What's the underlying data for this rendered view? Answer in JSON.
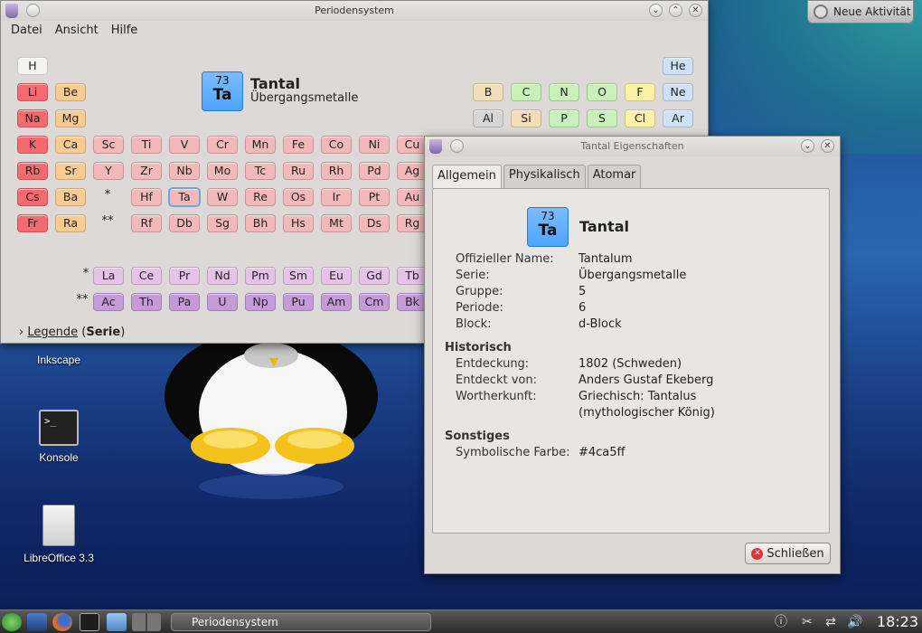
{
  "desktop": {
    "activity_button": "Neue Aktivität",
    "icons": [
      {
        "label": "Inkscape"
      },
      {
        "label": "Konsole"
      },
      {
        "label": "LibreOffice 3.3"
      }
    ]
  },
  "main_window": {
    "title": "Periodensystem",
    "menu": [
      "Datei",
      "Ansicht",
      "Hilfe"
    ],
    "selected": {
      "number": "73",
      "symbol": "Ta",
      "name": "Tantal",
      "series": "Übergangsmetalle"
    },
    "legend_label": "Legende",
    "legend_mode": "Serie",
    "lanthanide_marker": "*",
    "actinide_marker": "**"
  },
  "elements": [
    {
      "sym": "H",
      "series": "nm",
      "col": 0,
      "row": 0
    },
    {
      "sym": "He",
      "series": "nob",
      "col": 17,
      "row": 0
    },
    {
      "sym": "Li",
      "series": "alk",
      "col": 0,
      "row": 1
    },
    {
      "sym": "Be",
      "series": "ale",
      "col": 1,
      "row": 1
    },
    {
      "sym": "B",
      "series": "met",
      "col": 12,
      "row": 1
    },
    {
      "sym": "C",
      "series": "non",
      "col": 13,
      "row": 1
    },
    {
      "sym": "N",
      "series": "non",
      "col": 14,
      "row": 1
    },
    {
      "sym": "O",
      "series": "non",
      "col": 15,
      "row": 1
    },
    {
      "sym": "F",
      "series": "hal",
      "col": 16,
      "row": 1
    },
    {
      "sym": "Ne",
      "series": "nob",
      "col": 17,
      "row": 1
    },
    {
      "sym": "Na",
      "series": "alk",
      "col": 0,
      "row": 2
    },
    {
      "sym": "Mg",
      "series": "ale",
      "col": 1,
      "row": 2
    },
    {
      "sym": "Al",
      "series": "pt",
      "col": 12,
      "row": 2
    },
    {
      "sym": "Si",
      "series": "met",
      "col": 13,
      "row": 2
    },
    {
      "sym": "P",
      "series": "non",
      "col": 14,
      "row": 2
    },
    {
      "sym": "S",
      "series": "non",
      "col": 15,
      "row": 2
    },
    {
      "sym": "Cl",
      "series": "hal",
      "col": 16,
      "row": 2
    },
    {
      "sym": "Ar",
      "series": "nob",
      "col": 17,
      "row": 2
    },
    {
      "sym": "K",
      "series": "alk",
      "col": 0,
      "row": 3
    },
    {
      "sym": "Ca",
      "series": "ale",
      "col": 1,
      "row": 3
    },
    {
      "sym": "Sc",
      "series": "tm",
      "col": 2,
      "row": 3
    },
    {
      "sym": "Ti",
      "series": "tm",
      "col": 3,
      "row": 3
    },
    {
      "sym": "V",
      "series": "tm",
      "col": 4,
      "row": 3
    },
    {
      "sym": "Cr",
      "series": "tm",
      "col": 5,
      "row": 3
    },
    {
      "sym": "Mn",
      "series": "tm",
      "col": 6,
      "row": 3
    },
    {
      "sym": "Fe",
      "series": "tm",
      "col": 7,
      "row": 3
    },
    {
      "sym": "Co",
      "series": "tm",
      "col": 8,
      "row": 3
    },
    {
      "sym": "Ni",
      "series": "tm",
      "col": 9,
      "row": 3
    },
    {
      "sym": "Cu",
      "series": "tm",
      "col": 10,
      "row": 3
    },
    {
      "sym": "Rb",
      "series": "alk",
      "col": 0,
      "row": 4
    },
    {
      "sym": "Sr",
      "series": "ale",
      "col": 1,
      "row": 4
    },
    {
      "sym": "Y",
      "series": "tm",
      "col": 2,
      "row": 4
    },
    {
      "sym": "Zr",
      "series": "tm",
      "col": 3,
      "row": 4
    },
    {
      "sym": "Nb",
      "series": "tm",
      "col": 4,
      "row": 4
    },
    {
      "sym": "Mo",
      "series": "tm",
      "col": 5,
      "row": 4
    },
    {
      "sym": "Tc",
      "series": "tm",
      "col": 6,
      "row": 4
    },
    {
      "sym": "Ru",
      "series": "tm",
      "col": 7,
      "row": 4
    },
    {
      "sym": "Rh",
      "series": "tm",
      "col": 8,
      "row": 4
    },
    {
      "sym": "Pd",
      "series": "tm",
      "col": 9,
      "row": 4
    },
    {
      "sym": "Ag",
      "series": "tm",
      "col": 10,
      "row": 4
    },
    {
      "sym": "Cs",
      "series": "alk",
      "col": 0,
      "row": 5
    },
    {
      "sym": "Ba",
      "series": "ale",
      "col": 1,
      "row": 5
    },
    {
      "sym": "Hf",
      "series": "tm",
      "col": 3,
      "row": 5
    },
    {
      "sym": "Ta",
      "series": "sel",
      "col": 4,
      "row": 5
    },
    {
      "sym": "W",
      "series": "tm",
      "col": 5,
      "row": 5
    },
    {
      "sym": "Re",
      "series": "tm",
      "col": 6,
      "row": 5
    },
    {
      "sym": "Os",
      "series": "tm",
      "col": 7,
      "row": 5
    },
    {
      "sym": "Ir",
      "series": "tm",
      "col": 8,
      "row": 5
    },
    {
      "sym": "Pt",
      "series": "tm",
      "col": 9,
      "row": 5
    },
    {
      "sym": "Au",
      "series": "tm",
      "col": 10,
      "row": 5
    },
    {
      "sym": "Fr",
      "series": "alk",
      "col": 0,
      "row": 6
    },
    {
      "sym": "Ra",
      "series": "ale",
      "col": 1,
      "row": 6
    },
    {
      "sym": "Rf",
      "series": "tm",
      "col": 3,
      "row": 6
    },
    {
      "sym": "Db",
      "series": "tm",
      "col": 4,
      "row": 6
    },
    {
      "sym": "Sg",
      "series": "tm",
      "col": 5,
      "row": 6
    },
    {
      "sym": "Bh",
      "series": "tm",
      "col": 6,
      "row": 6
    },
    {
      "sym": "Hs",
      "series": "tm",
      "col": 7,
      "row": 6
    },
    {
      "sym": "Mt",
      "series": "tm",
      "col": 8,
      "row": 6
    },
    {
      "sym": "Ds",
      "series": "tm",
      "col": 9,
      "row": 6
    },
    {
      "sym": "Rg",
      "series": "tm",
      "col": 10,
      "row": 6
    },
    {
      "sym": "La",
      "series": "lan",
      "col": 2,
      "row": 8
    },
    {
      "sym": "Ce",
      "series": "lan",
      "col": 3,
      "row": 8
    },
    {
      "sym": "Pr",
      "series": "lan",
      "col": 4,
      "row": 8
    },
    {
      "sym": "Nd",
      "series": "lan",
      "col": 5,
      "row": 8
    },
    {
      "sym": "Pm",
      "series": "lan",
      "col": 6,
      "row": 8
    },
    {
      "sym": "Sm",
      "series": "lan",
      "col": 7,
      "row": 8
    },
    {
      "sym": "Eu",
      "series": "lan",
      "col": 8,
      "row": 8
    },
    {
      "sym": "Gd",
      "series": "lan",
      "col": 9,
      "row": 8
    },
    {
      "sym": "Tb",
      "series": "lan",
      "col": 10,
      "row": 8
    },
    {
      "sym": "Ac",
      "series": "act",
      "col": 2,
      "row": 9
    },
    {
      "sym": "Th",
      "series": "act",
      "col": 3,
      "row": 9
    },
    {
      "sym": "Pa",
      "series": "act",
      "col": 4,
      "row": 9
    },
    {
      "sym": "U",
      "series": "act",
      "col": 5,
      "row": 9
    },
    {
      "sym": "Np",
      "series": "act",
      "col": 6,
      "row": 9
    },
    {
      "sym": "Pu",
      "series": "act",
      "col": 7,
      "row": 9
    },
    {
      "sym": "Am",
      "series": "act",
      "col": 8,
      "row": 9
    },
    {
      "sym": "Cm",
      "series": "act",
      "col": 9,
      "row": 9
    },
    {
      "sym": "Bk",
      "series": "act",
      "col": 10,
      "row": 9
    }
  ],
  "dialog": {
    "title": "Tantal Eigenschaften",
    "tabs": [
      "Allgemein",
      "Physikalisch",
      "Atomar"
    ],
    "active_tab": "Allgemein",
    "element": {
      "number": "73",
      "symbol": "Ta",
      "name": "Tantal"
    },
    "general": [
      {
        "label": "Offizieller Name:",
        "value": "Tantalum"
      },
      {
        "label": "Serie:",
        "value": "Übergangsmetalle"
      },
      {
        "label": "Gruppe:",
        "value": "5"
      },
      {
        "label": "Periode:",
        "value": "6"
      },
      {
        "label": "Block:",
        "value": "d-Block"
      }
    ],
    "history_heading": "Historisch",
    "history": [
      {
        "label": "Entdeckung:",
        "value": "1802 (Schweden)"
      },
      {
        "label": "Entdeckt von:",
        "value": "Anders Gustaf Ekeberg"
      },
      {
        "label": "Wortherkunft:",
        "value": "Griechisch: Tantalus"
      },
      {
        "label": "",
        "value": "(mythologischer König)"
      }
    ],
    "misc_heading": "Sonstiges",
    "misc": [
      {
        "label": "Symbolische Farbe:",
        "value": "#4ca5ff"
      }
    ],
    "close_button": "Schließen"
  },
  "taskbar": {
    "task": "Periodensystem",
    "clock": "18:23"
  },
  "colors": {
    "element_color": "#4ca5ff"
  }
}
